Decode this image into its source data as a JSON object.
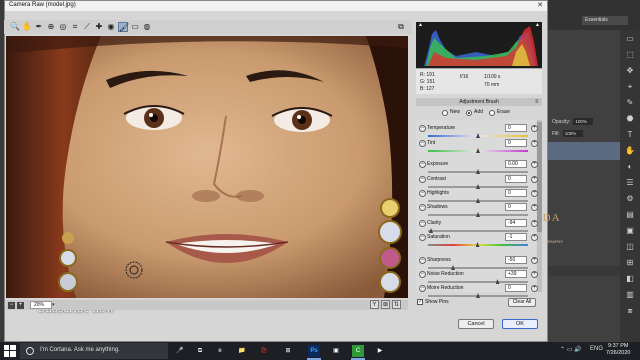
{
  "window": {
    "title": "Camera Raw (model.jpg)",
    "close": "✕"
  },
  "toolbar": {
    "tools": [
      {
        "icon": "zoom-icon",
        "glyph": "🔍",
        "active": false
      },
      {
        "icon": "hand-icon",
        "glyph": "✋",
        "active": false
      },
      {
        "icon": "white-balance-icon",
        "glyph": "✒",
        "active": false
      },
      {
        "icon": "color-sampler-icon",
        "glyph": "⊕",
        "active": false
      },
      {
        "icon": "target-adjustment-icon",
        "glyph": "◎",
        "active": false
      },
      {
        "icon": "crop-icon",
        "glyph": "⌗",
        "active": false
      },
      {
        "icon": "straighten-icon",
        "glyph": "⟋",
        "active": false
      },
      {
        "icon": "spot-removal-icon",
        "glyph": "✚",
        "active": false
      },
      {
        "icon": "red-eye-icon",
        "glyph": "◉",
        "active": false
      },
      {
        "icon": "adjustment-brush-icon",
        "glyph": "🖌",
        "active": true
      },
      {
        "icon": "graduated-filter-icon",
        "glyph": "▭",
        "active": false
      },
      {
        "icon": "radial-filter-icon",
        "glyph": "◍",
        "active": false
      }
    ],
    "right_icon": "⧉"
  },
  "status": {
    "zoom": "20%",
    "zoom_minus": "−",
    "zoom_plus": "+",
    "view_buttons": [
      "Y",
      "⊠",
      "⇅"
    ]
  },
  "watermark": "Subscribe now",
  "brand": {
    "logo_text": "IDA",
    "sub": "PHOTOGRAPHY"
  },
  "info": {
    "r": "R:  191",
    "g": "G:  151",
    "b": "B:  127",
    "aperture": "f/16",
    "shutter": "1/100 s",
    "focal": "70 mm"
  },
  "panel": {
    "title": "Adjustment Brush",
    "menu": "≡",
    "modes": [
      {
        "label": "New",
        "selected": false
      },
      {
        "label": "Add",
        "selected": true
      },
      {
        "label": "Erase",
        "selected": false
      }
    ],
    "adjustments": [
      {
        "label": "Temperature",
        "value": "0",
        "pos": 0.5,
        "track": "temp"
      },
      {
        "label": "Tint",
        "value": "0",
        "pos": 0.5,
        "track": "tint"
      },
      {
        "label": "Exposure",
        "value": "0.00",
        "pos": 0.5,
        "track": "gray"
      },
      {
        "label": "Contrast",
        "value": "0",
        "pos": 0.5,
        "track": "gray"
      },
      {
        "label": "Highlights",
        "value": "0",
        "pos": 0.5,
        "track": "gray"
      },
      {
        "label": "Shadows",
        "value": "0",
        "pos": 0.5,
        "track": "gray"
      },
      {
        "label": "Clarity",
        "value": "-94",
        "pos": 0.03,
        "track": "gray"
      },
      {
        "label": "Saturation",
        "value": "-1",
        "pos": 0.495,
        "track": "sat"
      },
      {
        "label": "Sharpness",
        "value": "-50",
        "pos": 0.25,
        "track": "gray"
      },
      {
        "label": "Noise Reduction",
        "value": "+39",
        "pos": 0.695,
        "track": "gray"
      },
      {
        "label": "Moire Reduction",
        "value": "0",
        "pos": 0.5,
        "track": "gray"
      }
    ],
    "show_pins": "Show Pins",
    "show_pins_checked": "✓",
    "clear_all": "Clear All"
  },
  "buttons": {
    "cancel": "Cancel",
    "ok": "OK"
  },
  "photoshop": {
    "workspace": "Essentials",
    "opacity_label": "Opacity:",
    "opacity": "100%",
    "fill_label": "Fill:",
    "fill": "100%",
    "tools": [
      "▭",
      "⬚",
      "✥",
      "⌖",
      "✎",
      "⬣",
      "T",
      "✋",
      "◐",
      "☰",
      "⚙",
      "▤",
      "▣",
      "◫",
      "⊞",
      "◧",
      "▥",
      "⧈"
    ]
  },
  "taskbar": {
    "search_placeholder": "I'm Cortana. Ask me anything.",
    "apps": [
      {
        "icon": "mic-icon",
        "glyph": "🎤"
      },
      {
        "icon": "task-view-icon",
        "glyph": "⧉"
      },
      {
        "icon": "edge-icon",
        "glyph": "e"
      },
      {
        "icon": "explorer-icon",
        "glyph": "📁"
      },
      {
        "icon": "store-icon",
        "glyph": "🛍"
      },
      {
        "icon": "windows-icon",
        "glyph": "⊞"
      },
      {
        "icon": "photoshop-icon",
        "glyph": "Ps"
      },
      {
        "icon": "app-icon",
        "glyph": "▣"
      },
      {
        "icon": "camtasia-icon",
        "glyph": "C"
      },
      {
        "icon": "media-icon",
        "glyph": "▶"
      }
    ],
    "lang": "ENG",
    "time": "9:37 PM",
    "date": "7/26/2020",
    "colors": {
      "photoshop": "#0a2a5c",
      "camtasia": "#2d9a37",
      "store": "#c0392b"
    }
  }
}
